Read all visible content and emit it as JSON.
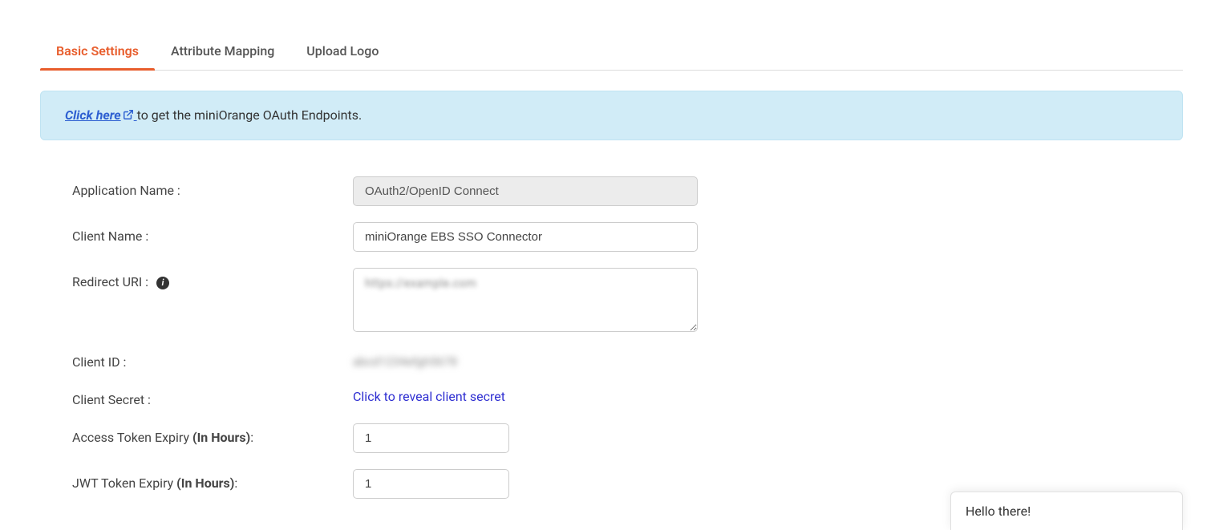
{
  "tabs": {
    "basic_settings": "Basic Settings",
    "attribute_mapping": "Attribute Mapping",
    "upload_logo": "Upload Logo"
  },
  "banner": {
    "link_text": "Click here",
    "rest_text": " to get the miniOrange OAuth Endpoints."
  },
  "form": {
    "application_name": {
      "label": "Application Name :",
      "value": "OAuth2/OpenID Connect"
    },
    "client_name": {
      "label": "Client Name :",
      "value": "miniOrange EBS SSO Connector"
    },
    "redirect_uri": {
      "label": "Redirect URI :",
      "value": "https://example.com"
    },
    "client_id": {
      "label": "Client ID :",
      "value": "abcd1234efgh5678"
    },
    "client_secret": {
      "label": "Client Secret :",
      "reveal_text": "Click to reveal client secret"
    },
    "access_token_expiry": {
      "label_pre": "Access Token Expiry ",
      "label_bold": "(In Hours)",
      "label_post": ":",
      "value": "1"
    },
    "jwt_token_expiry": {
      "label_pre": "JWT Token Expiry ",
      "label_bold": "(In Hours)",
      "label_post": ":",
      "value": "1"
    }
  },
  "chat": {
    "greeting": "Hello there!"
  }
}
